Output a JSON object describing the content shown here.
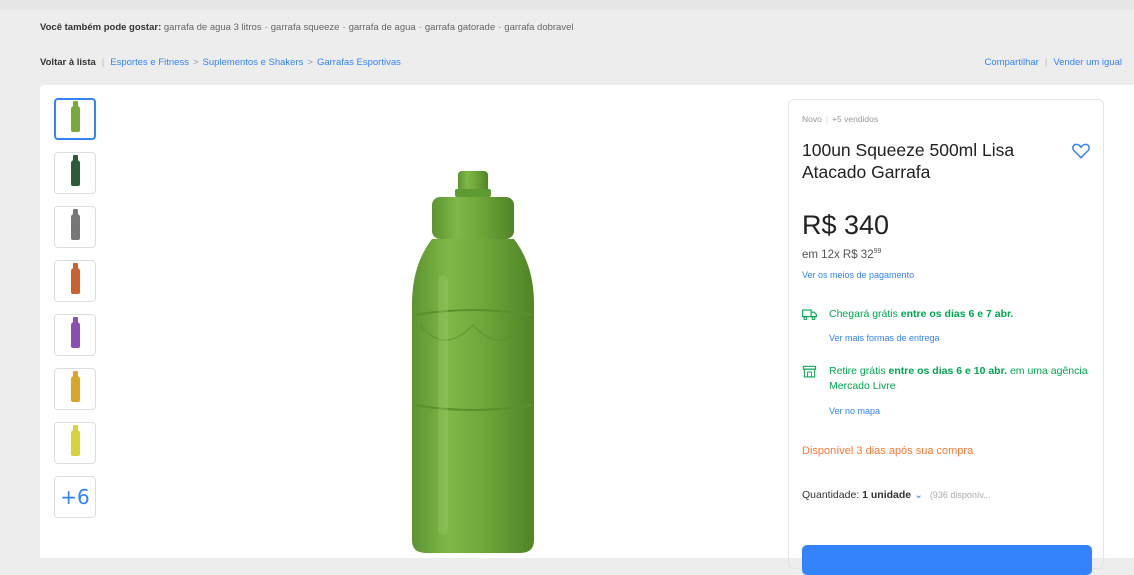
{
  "suggestions": {
    "prefix": "Você também pode gostar:",
    "items": [
      "garrafa de agua 3 litros",
      "garrafa squeeze",
      "garrafa de agua",
      "garrafa gatorade",
      "garrafa dobravel"
    ],
    "separators": [
      "-",
      "-",
      "-",
      "-"
    ]
  },
  "breadcrumb": {
    "back": "Voltar à lista",
    "items": [
      "Esportes e Fitness",
      "Suplementos e Shakers",
      "Garrafas Esportivas"
    ],
    "chevrons": [
      ">",
      ">"
    ],
    "share": "Compartilhar",
    "sell": "Vender um igual"
  },
  "gallery": {
    "thumb_colors": [
      "#7aa83b",
      "#2e5a3a",
      "#777777",
      "#c9622e",
      "#8a4fb0",
      "#d9a62a",
      "#d7d33a"
    ],
    "more_label": "+6",
    "main_color": "#6ea63a"
  },
  "product": {
    "condition": "Novo",
    "sold": "+5 vendidos",
    "title": "100un Squeeze 500ml Lisa Atacado Garrafa",
    "price": "R$ 340",
    "installments_prefix": "em 12x R$ 32",
    "installments_cents": "99",
    "payment_link": "Ver os meios de pagamento",
    "favorite_icon": "heart-outline-icon"
  },
  "shipping": {
    "delivery_text_pre": "Chegará grátis",
    "delivery_text_bold": "entre os dias 6 e 7 abr.",
    "delivery_link": "Ver mais formas de entrega",
    "pickup_text_pre": "Retire grátis",
    "pickup_text_bold": "entre os dias 6 e 10 abr.",
    "pickup_text_post": "em uma agência Mercado Livre",
    "pickup_link": "Ver no mapa",
    "accent": "#00a650"
  },
  "availability": "Disponível 3 dias após sua compra",
  "quantity": {
    "label": "Quantidade:",
    "value": "1 unidade",
    "caret": "⌄",
    "stock": "(936 disponív..."
  },
  "colors": {
    "link": "#3483fa",
    "warning": "#ff7733"
  }
}
